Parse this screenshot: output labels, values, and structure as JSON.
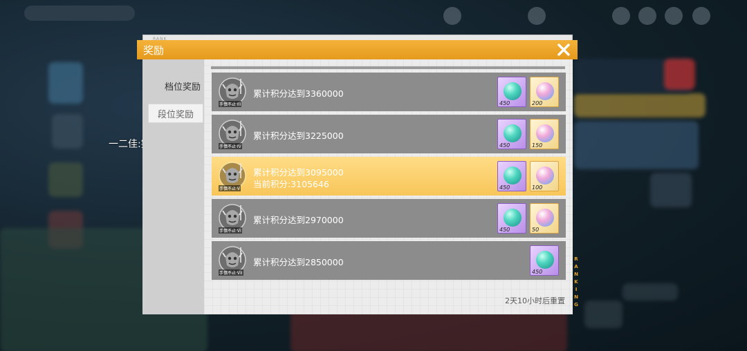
{
  "dialog": {
    "title": "奖励",
    "rank_tag": "RANK",
    "rank_vertical": "RANKING",
    "reset_text": "2天10小时后重置"
  },
  "sidebar": {
    "tabs": [
      {
        "label": "档位奖励",
        "selected": true
      },
      {
        "label": "段位奖励",
        "selected": false
      }
    ]
  },
  "chat": {
    "message": "一二佳:突然过了"
  },
  "tiers": [
    {
      "goal": "累计积分达到3360000",
      "badge_label": "手慎不止 III",
      "active": false,
      "rewards": [
        {
          "icon": "teal-orb-icon",
          "frame": "purple",
          "qty": "450"
        },
        {
          "icon": "pink-orb-icon",
          "frame": "gold",
          "qty": "200"
        }
      ]
    },
    {
      "goal": "累计积分达到3225000",
      "badge_label": "手慎不止 IV",
      "active": false,
      "rewards": [
        {
          "icon": "teal-orb-icon",
          "frame": "purple",
          "qty": "450"
        },
        {
          "icon": "pink-orb-icon",
          "frame": "gold",
          "qty": "150"
        }
      ]
    },
    {
      "goal": "累计积分达到3095000",
      "current": "当前积分:3105646",
      "badge_label": "手慎不止 V",
      "active": true,
      "rewards": [
        {
          "icon": "teal-orb-icon",
          "frame": "purple",
          "qty": "450"
        },
        {
          "icon": "pink-orb-icon",
          "frame": "gold",
          "qty": "100"
        }
      ]
    },
    {
      "goal": "累计积分达到2970000",
      "badge_label": "手慎不止 VI",
      "active": false,
      "rewards": [
        {
          "icon": "teal-orb-icon",
          "frame": "purple",
          "qty": "450"
        },
        {
          "icon": "pink-orb-icon",
          "frame": "gold",
          "qty": "50"
        }
      ]
    },
    {
      "goal": "累计积分达到2850000",
      "badge_label": "手慎不止 VII",
      "active": false,
      "rewards": [
        {
          "icon": "teal-orb-icon",
          "frame": "purple",
          "qty": "450"
        }
      ]
    }
  ],
  "colors": {
    "header": "#e9a226",
    "active_row": "#fbd06a",
    "row": "#8c8c8c"
  }
}
